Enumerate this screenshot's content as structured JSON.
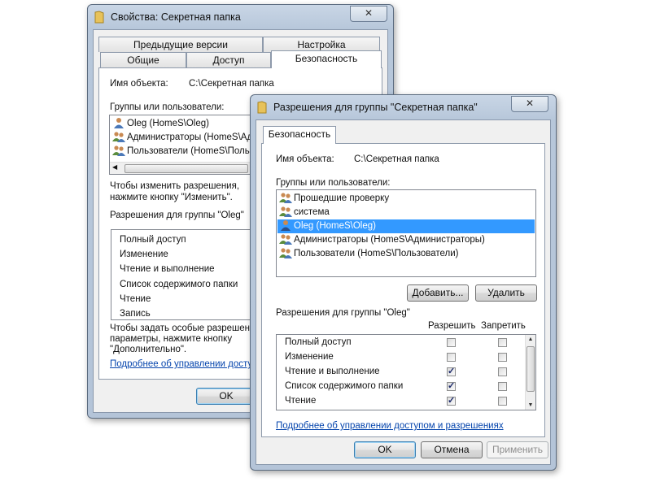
{
  "back_window": {
    "title": "Свойства: Секретная папка",
    "close": "✕",
    "tabs_row1": [
      "Предыдущие версии",
      "Настройка"
    ],
    "tabs_row2": [
      "Общие",
      "Доступ",
      "Безопасность"
    ],
    "object_label": "Имя объекта:",
    "object_value": "C:\\Секретная папка",
    "groups_label": "Группы или пользователи:",
    "users": [
      "Oleg (HomeS\\Oleg)",
      "Администраторы (HomeS\\Адми",
      "Пользователи (HomeS\\Пользо"
    ],
    "change_text_1": "Чтобы изменить разрешения,",
    "change_text_2": "нажмите кнопку \"Изменить\".",
    "perm_label": "Разрешения для группы \"Oleg\"",
    "perms": [
      "Полный доступ",
      "Изменение",
      "Чтение и выполнение",
      "Список содержимого папки",
      "Чтение",
      "Запись"
    ],
    "special_1": "Чтобы задать особые разрешения",
    "special_2": "параметры, нажмите кнопку",
    "special_3": "\"Дополнительно\".",
    "link": "Подробнее об управлении доступом",
    "ok": "OK"
  },
  "front_window": {
    "title": "Разрешения для группы \"Секретная папка\"",
    "close": "✕",
    "tab": "Безопасность",
    "object_label": "Имя объекта:",
    "object_value": "C:\\Секретная папка",
    "groups_label": "Группы или пользователи:",
    "users": [
      "Прошедшие проверку",
      "система",
      "Oleg (HomeS\\Oleg)",
      "Администраторы (HomeS\\Администраторы)",
      "Пользователи (HomeS\\Пользователи)"
    ],
    "selected_user_index": 2,
    "add_button": "Добавить...",
    "remove_button": "Удалить",
    "perm_label": "Разрешения для группы \"Oleg\"",
    "allow_header": "Разрешить",
    "deny_header": "Запретить",
    "perms": [
      {
        "name": "Полный доступ",
        "allow": false,
        "deny": false
      },
      {
        "name": "Изменение",
        "allow": false,
        "deny": false
      },
      {
        "name": "Чтение и выполнение",
        "allow": true,
        "deny": false
      },
      {
        "name": "Список содержимого папки",
        "allow": true,
        "deny": false
      },
      {
        "name": "Чтение",
        "allow": true,
        "deny": false
      }
    ],
    "link": "Подробнее об управлении доступом и разрешениях",
    "ok": "OK",
    "cancel": "Отмена",
    "apply": "Применить"
  }
}
